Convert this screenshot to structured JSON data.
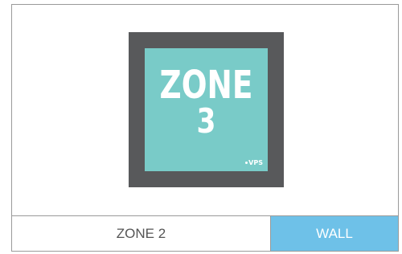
{
  "sign": {
    "zone_word": "ZONE",
    "zone_number": "3",
    "logo_text": "VPS",
    "outer_color": "#58595b",
    "inner_color": "#79cbc8"
  },
  "buttons": {
    "left_label": "ZONE 2",
    "right_label": "WALL",
    "right_color": "#6ec1e8"
  }
}
